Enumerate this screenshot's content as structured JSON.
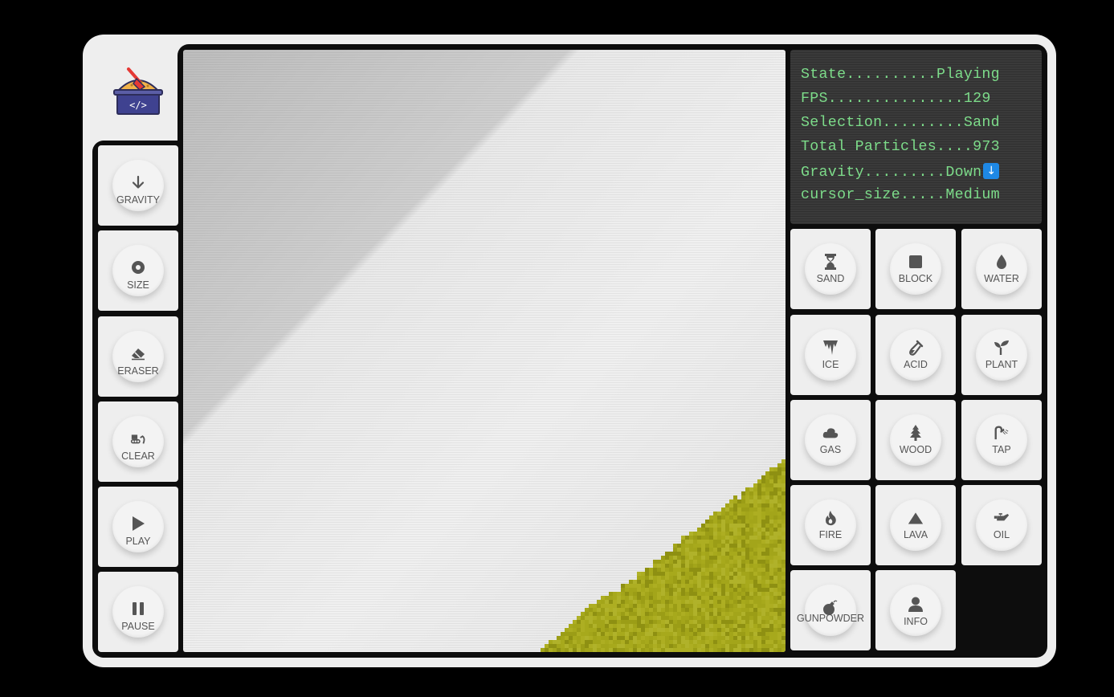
{
  "app": {
    "logo_name": "sand-code-logo"
  },
  "status": {
    "lines": [
      "State..........Playing",
      "FPS...............129",
      "Selection.........Sand",
      "Total Particles....973",
      "Gravity.........Down",
      "cursor_size.....Medium"
    ],
    "gravity_icon": "arrow-down-icon",
    "state": "Playing",
    "fps": 129,
    "selection": "Sand",
    "total_particles": 973,
    "gravity": "Down",
    "cursor_size": "Medium"
  },
  "controls": [
    {
      "label": "GRAVITY",
      "icon": "arrow-down-icon"
    },
    {
      "label": "SIZE",
      "icon": "target-icon"
    },
    {
      "label": "ERASER",
      "icon": "eraser-icon"
    },
    {
      "label": "CLEAR",
      "icon": "bulldozer-icon"
    },
    {
      "label": "PLAY",
      "icon": "play-icon"
    },
    {
      "label": "PAUSE",
      "icon": "pause-icon"
    }
  ],
  "elements": [
    {
      "label": "SAND",
      "icon": "hourglass-icon"
    },
    {
      "label": "BLOCK",
      "icon": "square-icon"
    },
    {
      "label": "WATER",
      "icon": "droplet-icon"
    },
    {
      "label": "ICE",
      "icon": "icicles-icon"
    },
    {
      "label": "ACID",
      "icon": "vial-icon"
    },
    {
      "label": "PLANT",
      "icon": "seedling-icon"
    },
    {
      "label": "GAS",
      "icon": "cloud-icon"
    },
    {
      "label": "WOOD",
      "icon": "tree-icon"
    },
    {
      "label": "TAP",
      "icon": "faucet-icon"
    },
    {
      "label": "FIRE",
      "icon": "fire-icon"
    },
    {
      "label": "LAVA",
      "icon": "mountain-icon"
    },
    {
      "label": "OIL",
      "icon": "oil-can-icon"
    },
    {
      "label": "GUNPOWDER",
      "icon": "bomb-icon"
    },
    {
      "label": "INFO",
      "icon": "user-icon"
    }
  ],
  "colors": {
    "sand": "#a6a81a",
    "sand_dark": "#8a8c12",
    "panel_text": "#7ddc8a",
    "gravity_badge": "#1e88e5"
  }
}
